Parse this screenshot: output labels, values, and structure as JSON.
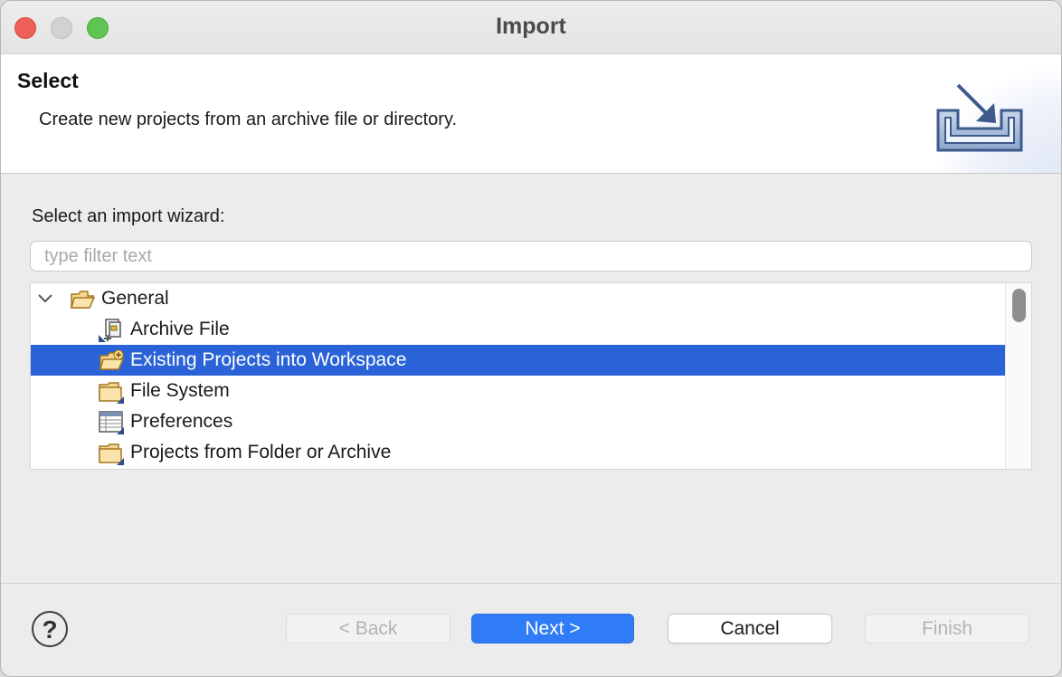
{
  "window": {
    "title": "Import"
  },
  "banner": {
    "title": "Select",
    "description": "Create new projects from an archive file or directory.",
    "icon": "import-wizard-icon"
  },
  "wizard": {
    "label": "Select an import wizard:",
    "filter_placeholder": "type filter text",
    "filter_value": ""
  },
  "tree": {
    "items": [
      {
        "label": "General",
        "icon": "folder-open-icon",
        "expanded": true,
        "level": 0
      },
      {
        "label": "Archive File",
        "icon": "archive-file-icon",
        "level": 1
      },
      {
        "label": "Existing Projects into Workspace",
        "icon": "folder-add-icon",
        "level": 1,
        "selected": true
      },
      {
        "label": "File System",
        "icon": "folder-icon",
        "level": 1
      },
      {
        "label": "Preferences",
        "icon": "preferences-table-icon",
        "level": 1
      },
      {
        "label": "Projects from Folder or Archive",
        "icon": "folder-icon",
        "level": 1
      }
    ]
  },
  "footer": {
    "help_label": "?",
    "back_label": "< Back",
    "next_label": "Next >",
    "cancel_label": "Cancel",
    "finish_label": "Finish"
  },
  "colors": {
    "selection": "#2a63d8",
    "primary_button": "#2f7cf6",
    "close": "#ee5f58",
    "zoom": "#5fc454"
  }
}
